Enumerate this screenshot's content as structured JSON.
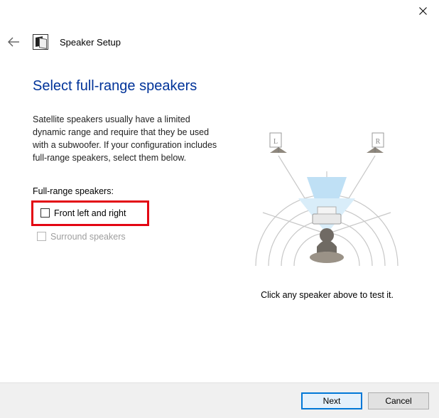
{
  "window": {
    "title": "Speaker Setup"
  },
  "page": {
    "heading": "Select full-range speakers",
    "intro": "Satellite speakers usually have a limited dynamic range and require that they be used with a subwoofer.  If your configuration includes full-range speakers, select them below.",
    "group_label": "Full-range speakers:",
    "options": {
      "front": {
        "label": "Front left and right"
      },
      "surround": {
        "label": "Surround speakers"
      }
    },
    "test_hint": "Click any speaker above to test it."
  },
  "diagram": {
    "left_speaker_label": "L",
    "right_speaker_label": "R"
  },
  "footer": {
    "next": "Next",
    "cancel": "Cancel"
  }
}
